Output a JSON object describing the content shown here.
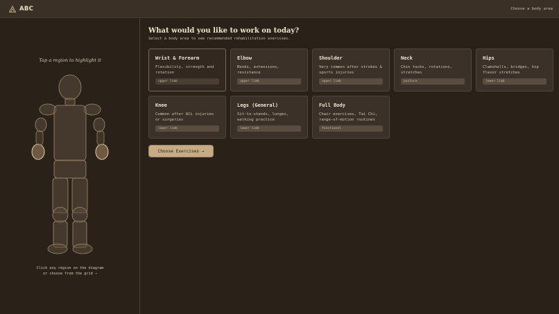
{
  "topbar": {
    "brand": "ABC",
    "hint": "Choose a body area"
  },
  "left": {
    "caption": "Tap a region to highlight it",
    "footer_line1": "Click any region on the diagram",
    "footer_line2": "or choose from the grid →"
  },
  "main": {
    "title": "What would you like to work on today?",
    "subtitle": "Select a body area to see recommended rehabilitation exercises.",
    "cta_label": "Choose Exercises →"
  },
  "cards": [
    {
      "title": "Wrist & Forearm",
      "desc": "Flexibility, strength and rotation",
      "tag": "upper limb",
      "selected": true
    },
    {
      "title": "Elbow",
      "desc": "Bends, extensions, resistance",
      "tag": "upper limb",
      "selected": false
    },
    {
      "title": "Shoulder",
      "desc": "Very common after strokes & sports injuries",
      "tag": "upper limb",
      "selected": false
    },
    {
      "title": "Neck",
      "desc": "Chin tucks, rotations, stretches",
      "tag": "posture",
      "selected": false
    },
    {
      "title": "Hips",
      "desc": "Clamshells, bridges, hip flexor stretches",
      "tag": "lower limb",
      "selected": false
    },
    {
      "title": "Knee",
      "desc": "Common after ACL injuries or surgeries",
      "tag": "lower limb",
      "selected": false
    },
    {
      "title": "Legs (General)",
      "desc": "Sit-to-stands, lunges, walking practice",
      "tag": "lower limb",
      "selected": false
    },
    {
      "title": "Full Body",
      "desc": "Chair exercises, Tai Chi, range-of-motion routines",
      "tag": "functional",
      "selected": false
    }
  ],
  "colors": {
    "accent": "#c7ab84",
    "background": "#2a2119",
    "panel": "#3b3128",
    "highlight": "#d9c29a"
  }
}
